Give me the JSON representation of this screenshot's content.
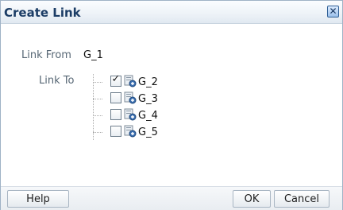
{
  "dialog": {
    "title": "Create Link",
    "close_glyph": "✕"
  },
  "form": {
    "link_from_label": "Link From",
    "link_from_value": "G_1",
    "link_to_label": "Link To"
  },
  "tree": {
    "items": [
      {
        "label": "G_2",
        "checked": true,
        "checkmark": "✓",
        "icon": "group-link-icon"
      },
      {
        "label": "G_3",
        "checked": false,
        "checkmark": "",
        "icon": "group-link-icon"
      },
      {
        "label": "G_4",
        "checked": false,
        "checkmark": "",
        "icon": "group-link-icon"
      },
      {
        "label": "G_5",
        "checked": false,
        "checkmark": "",
        "icon": "group-link-icon"
      }
    ]
  },
  "buttons": {
    "help": "Help",
    "ok": "OK",
    "cancel": "Cancel"
  },
  "colors": {
    "title_text": "#1c3d66",
    "icon_blue": "#3c6fb0",
    "icon_gray": "#8a98a6"
  }
}
